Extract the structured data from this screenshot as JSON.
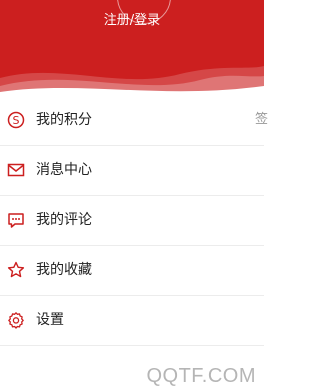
{
  "header": {
    "login_text": "注册/登录",
    "bg_color": "#cc1f1f"
  },
  "menu": {
    "icon_color": "#cc1f1f",
    "items": [
      {
        "label": "我的积分",
        "icon": "points-icon",
        "extra": "签"
      },
      {
        "label": "消息中心",
        "icon": "mail-icon"
      },
      {
        "label": "我的评论",
        "icon": "comment-icon"
      },
      {
        "label": "我的收藏",
        "icon": "star-icon"
      },
      {
        "label": "设置",
        "icon": "settings-icon"
      }
    ]
  },
  "watermark": "QQTF.COM"
}
